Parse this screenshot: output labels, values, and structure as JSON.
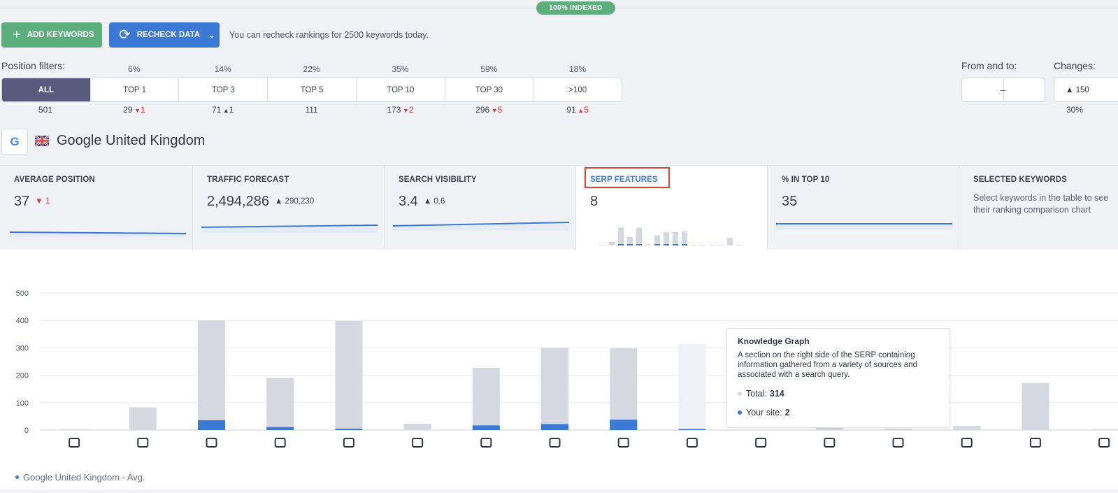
{
  "indexed_badge": "100% INDEXED",
  "toolbar": {
    "add_label": "ADD KEYWORDS",
    "recheck_label": "RECHECK DATA",
    "recheck_note": "You can recheck rankings for 2500 keywords today."
  },
  "position_filters": {
    "label": "Position filters:",
    "items": [
      {
        "label": "ALL",
        "pct": "",
        "count": "501",
        "change": "",
        "dir": ""
      },
      {
        "label": "TOP 1",
        "pct": "6%",
        "count": "29",
        "change": "1",
        "dir": "down"
      },
      {
        "label": "TOP 3",
        "pct": "14%",
        "count": "71",
        "change": "1",
        "dir": "up"
      },
      {
        "label": "TOP 5",
        "pct": "22%",
        "count": "111",
        "change": "",
        "dir": ""
      },
      {
        "label": "TOP 10",
        "pct": "35%",
        "count": "173",
        "change": "2",
        "dir": "down"
      },
      {
        "label": "TOP 30",
        "pct": "59%",
        "count": "296",
        "change": "5",
        "dir": "down"
      },
      {
        "label": ">100",
        "pct": "18%",
        "count": "91",
        "change": "5",
        "dir": "up-red"
      }
    ]
  },
  "range": {
    "label": "From and to:",
    "dash": "–"
  },
  "changes": {
    "label": "Changes:",
    "value": "▲ 150",
    "pct": "30%"
  },
  "engine": {
    "g_letter": "G",
    "title": "Google United Kingdom"
  },
  "cards": [
    {
      "title": "AVERAGE POSITION",
      "value": "37",
      "delta": "▼ 1",
      "delta_dir": "down"
    },
    {
      "title": "TRAFFIC FORECAST",
      "value": "2,494,286",
      "delta": "▲ 290,230",
      "delta_dir": "up"
    },
    {
      "title": "SEARCH VISIBILITY",
      "value": "3.4",
      "delta": "▲ 0.6",
      "delta_dir": "up"
    },
    {
      "title": "SERP FEATURES",
      "value": "8",
      "delta": "",
      "delta_dir": ""
    },
    {
      "title": "% IN TOP 10",
      "value": "35",
      "delta": "",
      "delta_dir": ""
    },
    {
      "title": "SELECTED KEYWORDS",
      "value": "",
      "delta": "",
      "description": "Select keywords in the table to see their ranking comparison chart"
    }
  ],
  "tooltip": {
    "title": "Knowledge Graph",
    "description": "A section on the right side of the SERP containing information gathered from a variety of sources and associated with a search query.",
    "total_label": "Total:",
    "total_value": "314",
    "site_label": "Your site:",
    "site_value": "2"
  },
  "legend": "Google United Kingdom - Avg.",
  "colors": {
    "total": "#d6d8e1",
    "site": "#3c79d4",
    "highlight": "#eef1f8",
    "accent_red": "#e0422f",
    "green": "#5dae7d",
    "blue": "#3c79d4"
  },
  "chart_data": {
    "type": "bar",
    "categories": [
      "featured-snippet",
      "local-pack",
      "reviews",
      "sitelinks",
      "video",
      "carousel",
      "top-stories",
      "people-also-ask",
      "images",
      "knowledge-graph",
      "knowledge-panel",
      "ads-top",
      "ads-bottom",
      "shopping",
      "twitter",
      "hotels"
    ],
    "series": [
      {
        "key": "total",
        "values": [
          2,
          83,
          400,
          190,
          398,
          23,
          227,
          300,
          298,
          314,
          0,
          12,
          5,
          15,
          172,
          2
        ]
      },
      {
        "key": "site",
        "values": [
          0,
          0,
          36,
          11,
          5,
          0,
          17,
          22,
          38,
          2,
          0,
          0,
          0,
          0,
          0,
          0
        ]
      }
    ],
    "highlight_index": 9,
    "yticks": [
      "0",
      "100",
      "200",
      "300",
      "400",
      "500"
    ],
    "ylim": [
      0,
      500
    ],
    "grid": true
  },
  "icons": [
    "featured-snippet-icon",
    "local-pack-icon",
    "reviews-icon",
    "sitelinks-icon",
    "video-icon",
    "carousel-icon",
    "top-stories-icon",
    "people-also-ask-icon",
    "images-icon",
    "knowledge-graph-icon",
    "knowledge-panel-icon",
    "ads-top-icon",
    "ads-bottom-icon",
    "shopping-icon",
    "twitter-icon",
    "hotels-icon"
  ]
}
